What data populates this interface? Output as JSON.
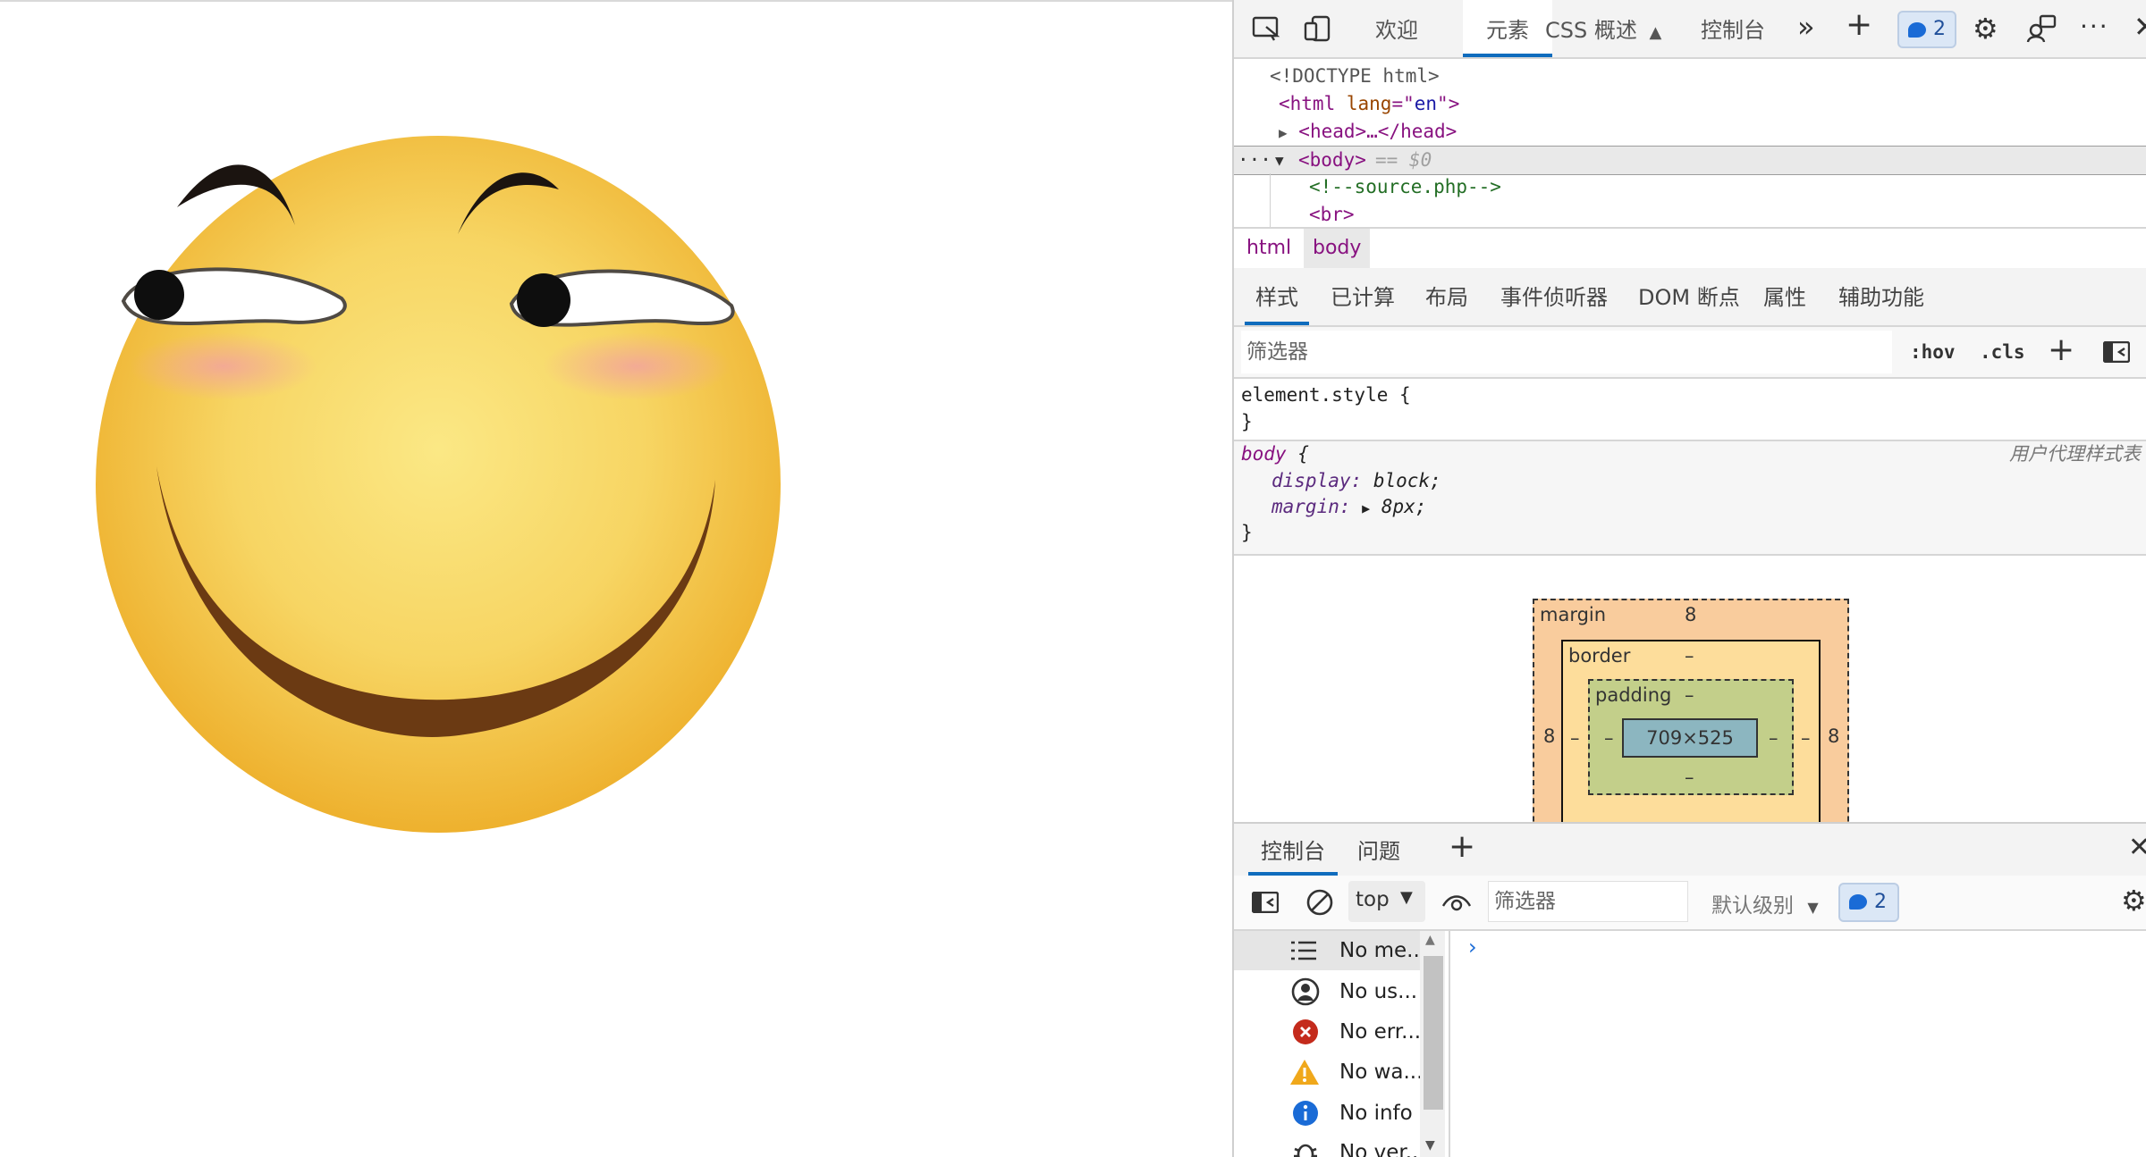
{
  "toolbar": {
    "welcome": "欢迎",
    "elements": "元素",
    "css_overview": "CSS 概述",
    "console": "控制台",
    "issues_count": "2"
  },
  "dom": {
    "doctype": "<!DOCTYPE html>",
    "html_open_tag": "<html",
    "html_lang_attr": "lang",
    "html_lang_eq": "=\"",
    "html_lang_val": "en",
    "html_lang_close": "\">",
    "head": "<head>…</head>",
    "ellipsis": "···",
    "body_tag": "<body>",
    "body_ref": "== $0",
    "comment": "<!--source.php-->",
    "br": "<br>"
  },
  "breadcrumb": [
    "html",
    "body"
  ],
  "styles_tabs": [
    "样式",
    "已计算",
    "布局",
    "事件侦听器",
    "DOM 断点",
    "属性",
    "辅助功能"
  ],
  "styles_filter": {
    "placeholder": "筛选器",
    "hov": ":hov",
    "cls": ".cls"
  },
  "rules": {
    "element_selector": "element.style {",
    "close": "}",
    "body_selector": "body",
    "body_open": "{",
    "origin": "用户代理样式表",
    "display_prop": "display:",
    "display_val": "block;",
    "margin_prop": "margin:",
    "margin_val": "8px;"
  },
  "box_model": {
    "margin_label": "margin",
    "margin_top": "8",
    "margin_left": "8",
    "margin_right": "8",
    "border_label": "border",
    "border_top": "–",
    "border_left": "–",
    "border_right": "–",
    "border_bottom": "–",
    "padding_label": "padding",
    "padding_top": "–",
    "padding_left": "–",
    "padding_right": "–",
    "padding_bottom": "–",
    "content": "709×525"
  },
  "drawer": {
    "console": "控制台",
    "issues": "问题"
  },
  "console_toolbar": {
    "context": "top",
    "filter_placeholder": "筛选器",
    "level": "默认级别",
    "issues_count": "2"
  },
  "console_sidebar": [
    {
      "label": "No me...",
      "icon": "list-icon"
    },
    {
      "label": "No us...",
      "icon": "user-icon"
    },
    {
      "label": "No err...",
      "icon": "error-icon"
    },
    {
      "label": "No wa...",
      "icon": "warning-icon"
    },
    {
      "label": "No info",
      "icon": "info-icon"
    },
    {
      "label": "No ver...",
      "icon": "bug-icon"
    }
  ],
  "colors": {
    "accent": "#0f6cbd",
    "face": "#f7d463",
    "face_edge": "#efb52f",
    "blush": "#f4a7a0",
    "mouth": "#6b3a13"
  },
  "console_prompt": "›"
}
